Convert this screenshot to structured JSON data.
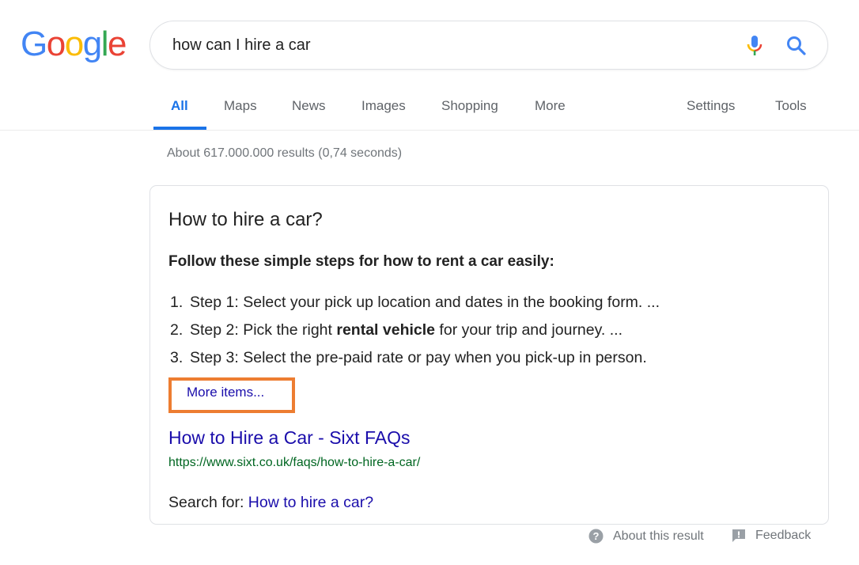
{
  "logo": {
    "letters": [
      {
        "char": "G",
        "color": "#4285F4"
      },
      {
        "char": "o",
        "color": "#EA4335"
      },
      {
        "char": "o",
        "color": "#FBBC05"
      },
      {
        "char": "g",
        "color": "#4285F4"
      },
      {
        "char": "l",
        "color": "#34A853"
      },
      {
        "char": "e",
        "color": "#EA4335"
      }
    ]
  },
  "search": {
    "query": "how can I hire a car",
    "mic_icon": "microphone-icon",
    "search_icon": "search-icon"
  },
  "tabs": {
    "items": [
      {
        "label": "All",
        "active": true
      },
      {
        "label": "Maps",
        "active": false
      },
      {
        "label": "News",
        "active": false
      },
      {
        "label": "Images",
        "active": false
      },
      {
        "label": "Shopping",
        "active": false
      },
      {
        "label": "More",
        "active": false
      }
    ],
    "settings": "Settings",
    "tools": "Tools",
    "accent_color": "#1a73e8"
  },
  "stats": "About 617.000.000 results (0,74 seconds)",
  "featured_snippet": {
    "title": "How to hire a car?",
    "subtitle": "Follow these simple steps for how to rent a car easily:",
    "steps": [
      {
        "num": "1.",
        "before": "Step 1: Select your pick up location and dates in the booking form. ...",
        "bold": "",
        "after": ""
      },
      {
        "num": "2.",
        "before": "Step 2: Pick the right ",
        "bold": "rental vehicle",
        "after": " for your trip and journey. ..."
      },
      {
        "num": "3.",
        "before": "Step 3: Select the pre-paid rate or pay when you pick-up in person.",
        "bold": "",
        "after": ""
      }
    ],
    "more_items": "More items...",
    "highlight_color": "#ed7d31",
    "result_title": "How to Hire a Car - Sixt FAQs",
    "result_url": "https://www.sixt.co.uk/faqs/how-to-hire-a-car/",
    "search_for_label": "Search for: ",
    "search_for_link": "How to hire a car?"
  },
  "footer": {
    "about": "About this result",
    "about_icon": "help-circle-icon",
    "feedback": "Feedback",
    "feedback_icon": "feedback-icon"
  }
}
